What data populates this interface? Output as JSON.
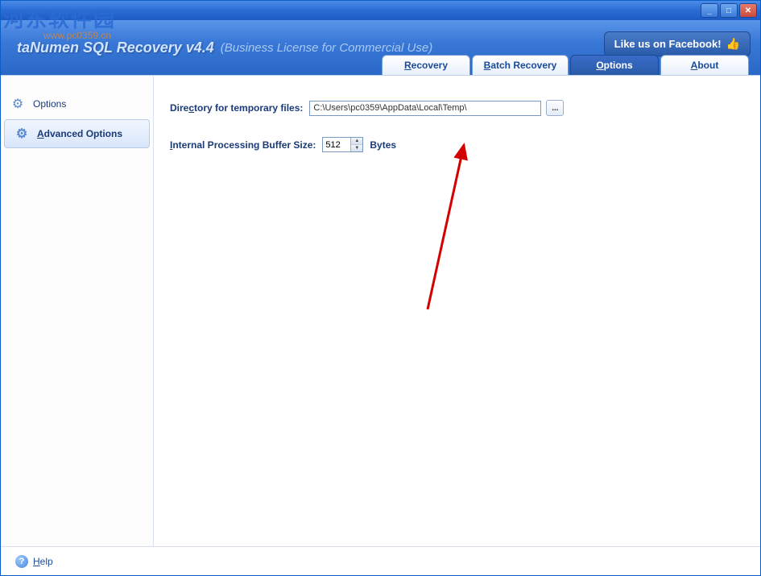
{
  "watermark": {
    "title": "河东软件园",
    "subtitle": "www.pc0359.cn"
  },
  "header": {
    "app_title": "taNumen SQL Recovery v4.4",
    "app_subtitle": "(Business License for Commercial Use)",
    "facebook_label": "Like us on Facebook!"
  },
  "tabs": {
    "recovery": "Recovery",
    "batch": "Batch Recovery",
    "options": "Options",
    "about": "About"
  },
  "sidebar": {
    "options": "Options",
    "advanced_options": "Advanced Options"
  },
  "form": {
    "dir_label_pre": "Dire",
    "dir_label_u": "c",
    "dir_label_post": "tory for temporary files:",
    "dir_value": "C:\\Users\\pc0359\\AppData\\Local\\Temp\\",
    "browse_label": "...",
    "buffer_label_u": "I",
    "buffer_label_post": "nternal Processing Buffer Size:",
    "buffer_value": "512",
    "bytes_label": "Bytes"
  },
  "footer": {
    "help_u": "H",
    "help_post": "elp"
  },
  "window_controls": {
    "minimize": "_",
    "maximize": "□",
    "close": "✕"
  }
}
